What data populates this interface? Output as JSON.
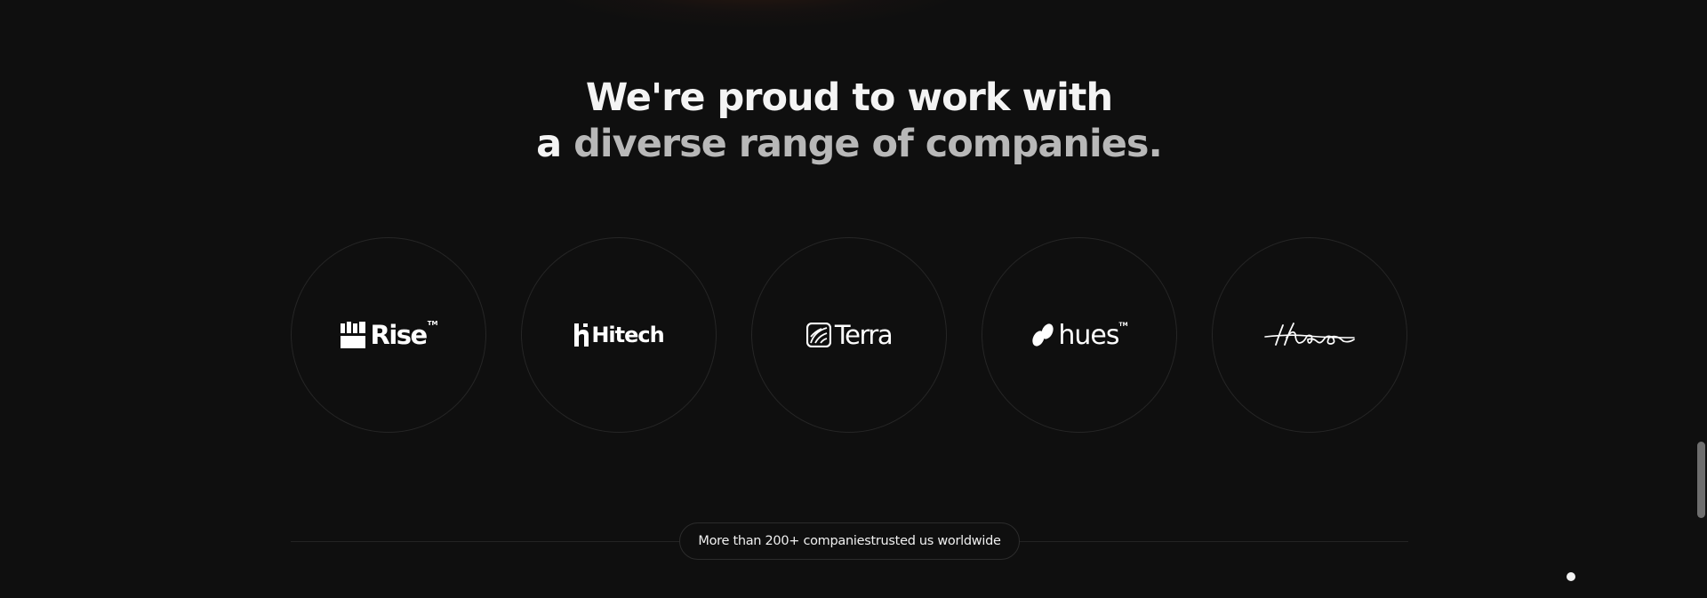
{
  "heading": {
    "line1": "We're proud to work with",
    "line2_lead": "a",
    "line2_muted": "diverse range of companies."
  },
  "logos": [
    {
      "name": "Rise",
      "icon": "rise-blocks-icon",
      "tm": "TM"
    },
    {
      "name": "Hitech",
      "icon": "hitech-h-icon"
    },
    {
      "name": "Terra",
      "icon": "terra-leaf-icon"
    },
    {
      "name": "hues",
      "icon": "hues-drops-icon",
      "tm": "TM"
    },
    {
      "name": "theo",
      "icon": "theo-signature-icon"
    }
  ],
  "badge": {
    "text": "More than 200+ companiestrusted us worldwide"
  },
  "colors": {
    "background": "#0f0f0f",
    "heading": "#f4f4f4",
    "heading_muted": "#b8b8b8",
    "circle_border": "#262626",
    "line": "#242424"
  }
}
